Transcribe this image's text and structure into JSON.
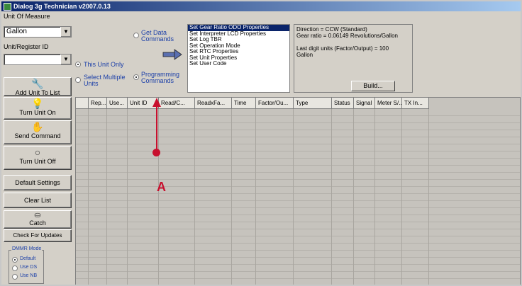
{
  "window": {
    "title": "Dialog 3g Technician v2007.0.13"
  },
  "unit_of_measure": {
    "label": "Unit Of Measure",
    "value": "Gallon"
  },
  "unit_register_id": {
    "label": "Unit/Register ID",
    "value": ""
  },
  "scope": {
    "this_unit_only": "This Unit Only",
    "select_multiple": "Select Multiple Units",
    "selected": "this_unit_only"
  },
  "command_type": {
    "get_data": "Get Data Commands",
    "programming": "Programming Commands",
    "selected": "programming"
  },
  "commands": [
    {
      "label": "Set Gear Ratio ODO Properties",
      "selected": true
    },
    {
      "label": "Set Interpreter LCD Properties",
      "selected": false
    },
    {
      "label": "Set Log TBR",
      "selected": false
    },
    {
      "label": "Set Operation Mode",
      "selected": false
    },
    {
      "label": "Set RTC Properties",
      "selected": false
    },
    {
      "label": "Set Unit Properties",
      "selected": false
    },
    {
      "label": "Set User Code",
      "selected": false
    }
  ],
  "info": {
    "line1": "Direction = CCW (Standard)",
    "line2": "Gear ratio = 0.06149 Revolutions/Gallon",
    "line3": "Last digit units (Factor/Output) = 100",
    "line4": "Gallon",
    "build_label": "Build..."
  },
  "sidebar": {
    "add_unit": "Add Unit To List",
    "turn_on": "Turn Unit On",
    "send": "Send Command",
    "turn_off": "Turn Unit Off",
    "defaults": "Default Settings",
    "clear": "Clear List",
    "catch": "Catch",
    "updates": "Check For Updates"
  },
  "dmmr": {
    "label": "DMMR Mode",
    "options": [
      "Default",
      "Use DS",
      "Use NB"
    ],
    "selected": "Default"
  },
  "grid": {
    "columns": [
      "Rep...",
      "Use...",
      "Unit ID",
      "Read/C...",
      "ReadxFa...",
      "Time",
      "Factor/Ou...",
      "Type",
      "Status",
      "Signal",
      "Meter S/...",
      "TX In..."
    ]
  },
  "annotation": {
    "label": "A",
    "color": "#c8102e"
  },
  "colors": {
    "selection": "#0a246a",
    "radio_text": "#1b3fa8",
    "window_bg": "#d4d0c8",
    "grid_bg": "#c6c3bd"
  }
}
